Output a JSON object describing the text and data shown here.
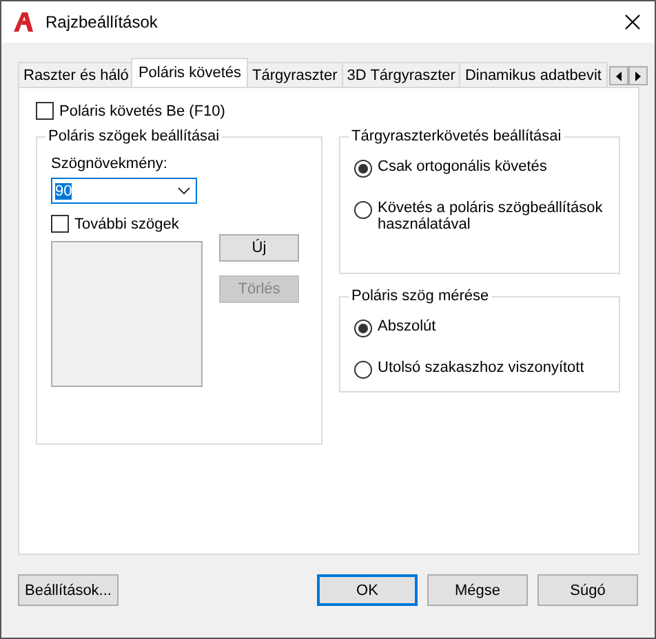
{
  "window": {
    "title": "Rajzbeállítások"
  },
  "tabs": [
    {
      "label": "Raszter és háló",
      "selected": false
    },
    {
      "label": "Poláris követés",
      "selected": true
    },
    {
      "label": "Tárgyraszter",
      "selected": false
    },
    {
      "label": "3D Tárgyraszter",
      "selected": false
    },
    {
      "label": "Dinamikus adatbevit",
      "selected": false
    }
  ],
  "polar_tracking": {
    "label": "Poláris követés Be (F10)",
    "checked": false
  },
  "polar_angles": {
    "title": "Poláris szögek beállításai",
    "increment_label": "Szögnövekmény:",
    "increment_value": "90",
    "additional": {
      "label": "További szögek",
      "checked": false
    },
    "buttons": [
      {
        "label": "Új",
        "disabled": false
      },
      {
        "label": "Törlés",
        "disabled": true
      }
    ]
  },
  "object_snap_tracking": {
    "title": "Tárgyraszterkövetés beállításai",
    "options": [
      {
        "label": "Csak ortogonális követés",
        "selected": true
      },
      {
        "label": "Követés a poláris szögbeállítások használatával",
        "selected": false
      }
    ]
  },
  "polar_measure": {
    "title": "Poláris szög mérése",
    "options": [
      {
        "label": "Abszolút",
        "selected": true
      },
      {
        "label": "Utolsó szakaszhoz viszonyított",
        "selected": false
      }
    ]
  },
  "buttons": [
    {
      "label": "Beállítások...",
      "default": false
    },
    {
      "label": "OK",
      "default": true
    },
    {
      "label": "Mégse",
      "default": false
    },
    {
      "label": "Súgó",
      "default": false
    }
  ]
}
